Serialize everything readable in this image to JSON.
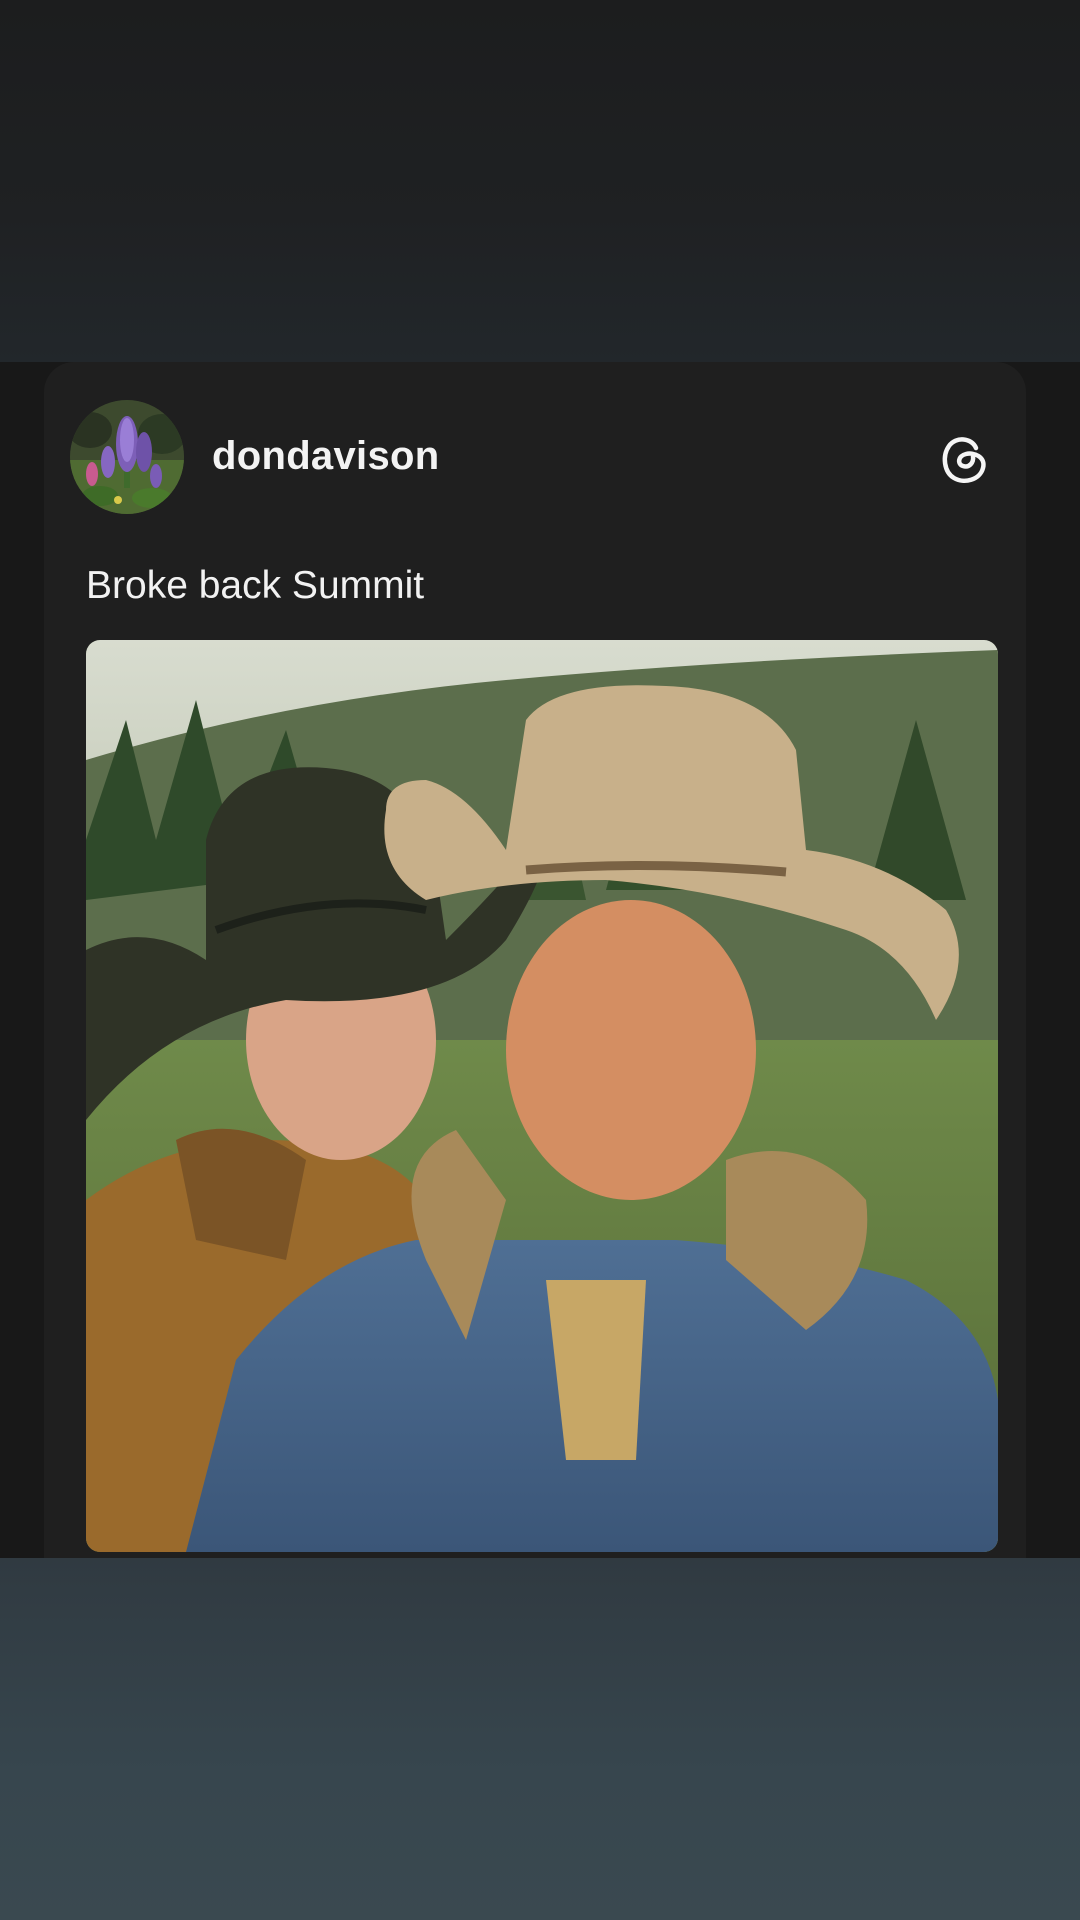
{
  "post": {
    "username": "dondavison",
    "caption": "Broke back Summit",
    "avatar_icon": "lupine-flowers-avatar",
    "platform_icon": "threads-logo-icon",
    "image_icon": "two-cowboys-photo"
  },
  "colors": {
    "card_background": "#1f1f1f",
    "text_primary": "#f3f3f3",
    "bottom_gradient": "#37464e"
  }
}
